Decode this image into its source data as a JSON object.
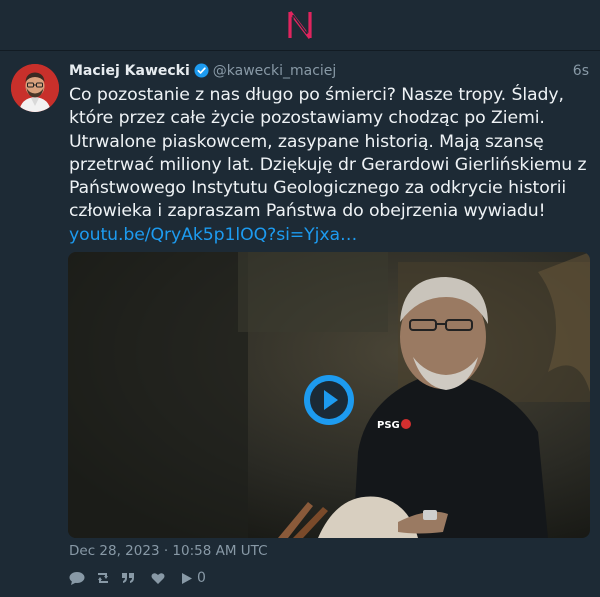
{
  "app": {
    "logo_letter": "N",
    "logo_color": "#e0245e"
  },
  "tweet": {
    "author_name": "Maciej Kawecki",
    "author_handle": "@kawecki_maciej",
    "relative_time": "6s",
    "text_line1": "Co pozostanie z nas długo po śmierci? Nasze tropy. Ślady, które przez całe życie pozostawiamy chodząc po Ziemi. Utrwalone piaskowcem, zasypane historią. Mają szansę przetrwać miliony lat. Dziękuję dr Gerardowi Gierlińskiemu z Państwowego Instytutu Geologicznego za odkrycie historii człowieka i zapraszam Państwa do obejrzenia wywiadu!",
    "link_text": "youtu.be/QryAk5p1lOQ?si=Yjxa…",
    "date": "Dec 28, 2023 · 10:58 AM UTC",
    "play_count": "0",
    "verified_color": "#1d9bf0",
    "accent_color": "#1d9bf0"
  },
  "video": {
    "jacket_label": "PSG"
  },
  "icons": {
    "reply": "comment-icon",
    "retweet": "retweet-icon",
    "quote": "quote-icon",
    "like": "heart-icon",
    "play": "play-icon"
  }
}
